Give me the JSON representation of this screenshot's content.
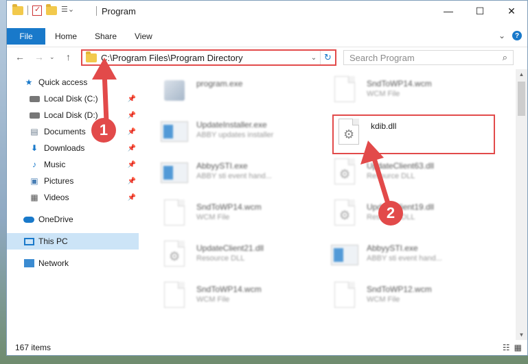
{
  "window": {
    "title": "Program",
    "controls": {
      "minimize": "—",
      "maximize": "☐",
      "close": "✕"
    }
  },
  "ribbon": {
    "tabs": {
      "file": "File",
      "home": "Home",
      "share": "Share",
      "view": "View"
    },
    "expand": "⌄",
    "help": "?"
  },
  "nav": {
    "back": "←",
    "forward": "→",
    "dropdown": "⌄",
    "up": "↑",
    "address": "C:\\Program Files\\Program Directory",
    "address_chevron": "⌄",
    "refresh": "↻",
    "search_placeholder": "Search Program",
    "search_icon": "⌕"
  },
  "sidebar": {
    "items": [
      {
        "label": "Quick access",
        "icon": "star-icon",
        "pinned": false
      },
      {
        "label": "Local Disk (C:)",
        "icon": "drive-icon",
        "pinned": true
      },
      {
        "label": "Local Disk (D:)",
        "icon": "drive-icon",
        "pinned": true
      },
      {
        "label": "Documents",
        "icon": "documents-icon",
        "pinned": true
      },
      {
        "label": "Downloads",
        "icon": "downloads-icon",
        "pinned": true
      },
      {
        "label": "Music",
        "icon": "music-icon",
        "pinned": true
      },
      {
        "label": "Pictures",
        "icon": "pictures-icon",
        "pinned": true
      },
      {
        "label": "Videos",
        "icon": "videos-icon",
        "pinned": true
      },
      {
        "label": "OneDrive",
        "icon": "onedrive-icon",
        "pinned": false
      },
      {
        "label": "This PC",
        "icon": "this-pc-icon",
        "pinned": false,
        "selected": true
      },
      {
        "label": "Network",
        "icon": "network-icon",
        "pinned": false
      }
    ],
    "pin_glyph": "📌"
  },
  "files": [
    {
      "name": "program.exe",
      "desc": "",
      "kind": "exe"
    },
    {
      "name": "SndToWP14.wcm",
      "desc": "WCM File",
      "kind": "doc"
    },
    {
      "name": "UpdateInstaller.exe",
      "desc": "ABBY updates installer",
      "kind": "app"
    },
    {
      "name": "kdib.dll",
      "desc": "",
      "kind": "dll",
      "highlighted": true
    },
    {
      "name": "AbbyySTI.exe",
      "desc": "ABBY sti event hand...",
      "kind": "app"
    },
    {
      "name": "UpdateClient63.dll",
      "desc": "Resource DLL",
      "kind": "dll"
    },
    {
      "name": "SndToWP14.wcm",
      "desc": "WCM File",
      "kind": "doc"
    },
    {
      "name": "UpdateClient19.dll",
      "desc": "Resource DLL",
      "kind": "dll"
    },
    {
      "name": "UpdateClient21.dll",
      "desc": "Resource DLL",
      "kind": "dll"
    },
    {
      "name": "AbbyySTI.exe",
      "desc": "ABBY sti event hand...",
      "kind": "app"
    },
    {
      "name": "SndToWP14.wcm",
      "desc": "WCM File",
      "kind": "doc"
    },
    {
      "name": "SndToWP12.wcm",
      "desc": "WCM File",
      "kind": "doc"
    }
  ],
  "callouts": {
    "one": "1",
    "two": "2"
  },
  "status": {
    "item_count": "167 items"
  },
  "colors": {
    "accent": "#1979ca",
    "annotation_red": "#e24a4a",
    "selected_bg": "#cce4f7"
  }
}
